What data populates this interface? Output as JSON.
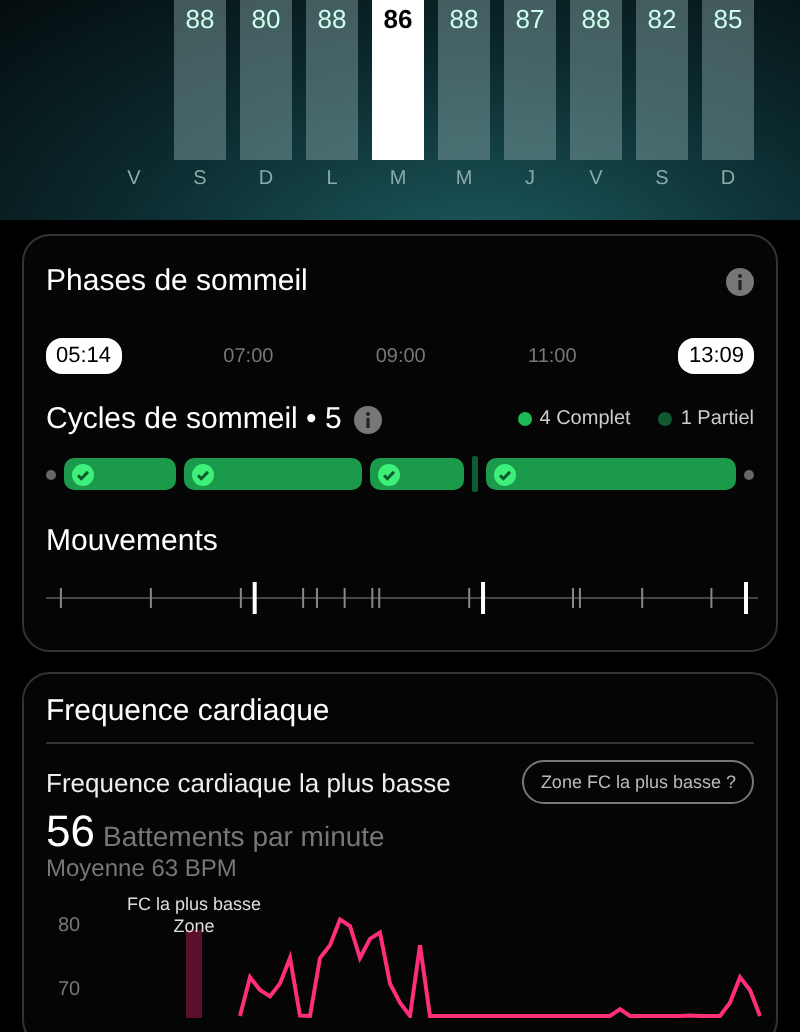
{
  "week": [
    {
      "day": "V"
    },
    {
      "day": "S",
      "score": "88",
      "selected": false
    },
    {
      "day": "D",
      "score": "80",
      "selected": false
    },
    {
      "day": "L",
      "score": "88",
      "selected": false
    },
    {
      "day": "M",
      "score": "86",
      "selected": true
    },
    {
      "day": "M",
      "score": "88",
      "selected": false
    },
    {
      "day": "J",
      "score": "87",
      "selected": false
    },
    {
      "day": "V",
      "score": "88",
      "selected": false
    },
    {
      "day": "S",
      "score": "82",
      "selected": false
    },
    {
      "day": "D",
      "score": "85",
      "selected": false
    }
  ],
  "phases": {
    "title": "Phases de sommeil",
    "start": "05:14",
    "end": "13:09",
    "ticks": [
      "07:00",
      "09:00",
      "11:00"
    ]
  },
  "cycles": {
    "title": "Cycles de sommeil • 5",
    "legend": [
      {
        "label": "4 Complet",
        "color": "#1db954"
      },
      {
        "label": "1 Partiel",
        "color": "#0f5a30"
      }
    ],
    "segments": [
      {
        "kind": "complete"
      },
      {
        "kind": "complete"
      },
      {
        "kind": "complete"
      },
      {
        "kind": "partial"
      },
      {
        "kind": "complete"
      }
    ]
  },
  "movements": {
    "title": "Mouvements"
  },
  "heart": {
    "title": "Frequence cardiaque",
    "subtitle": "Frequence cardiaque la plus basse",
    "button": "Zone FC la plus basse ?",
    "value": "56",
    "unit": "Battements par minute",
    "average": "Moyenne 63 BPM",
    "chart": {
      "ticks": [
        "80",
        "70"
      ],
      "zone_label": "FC la plus basse Zone"
    }
  }
}
